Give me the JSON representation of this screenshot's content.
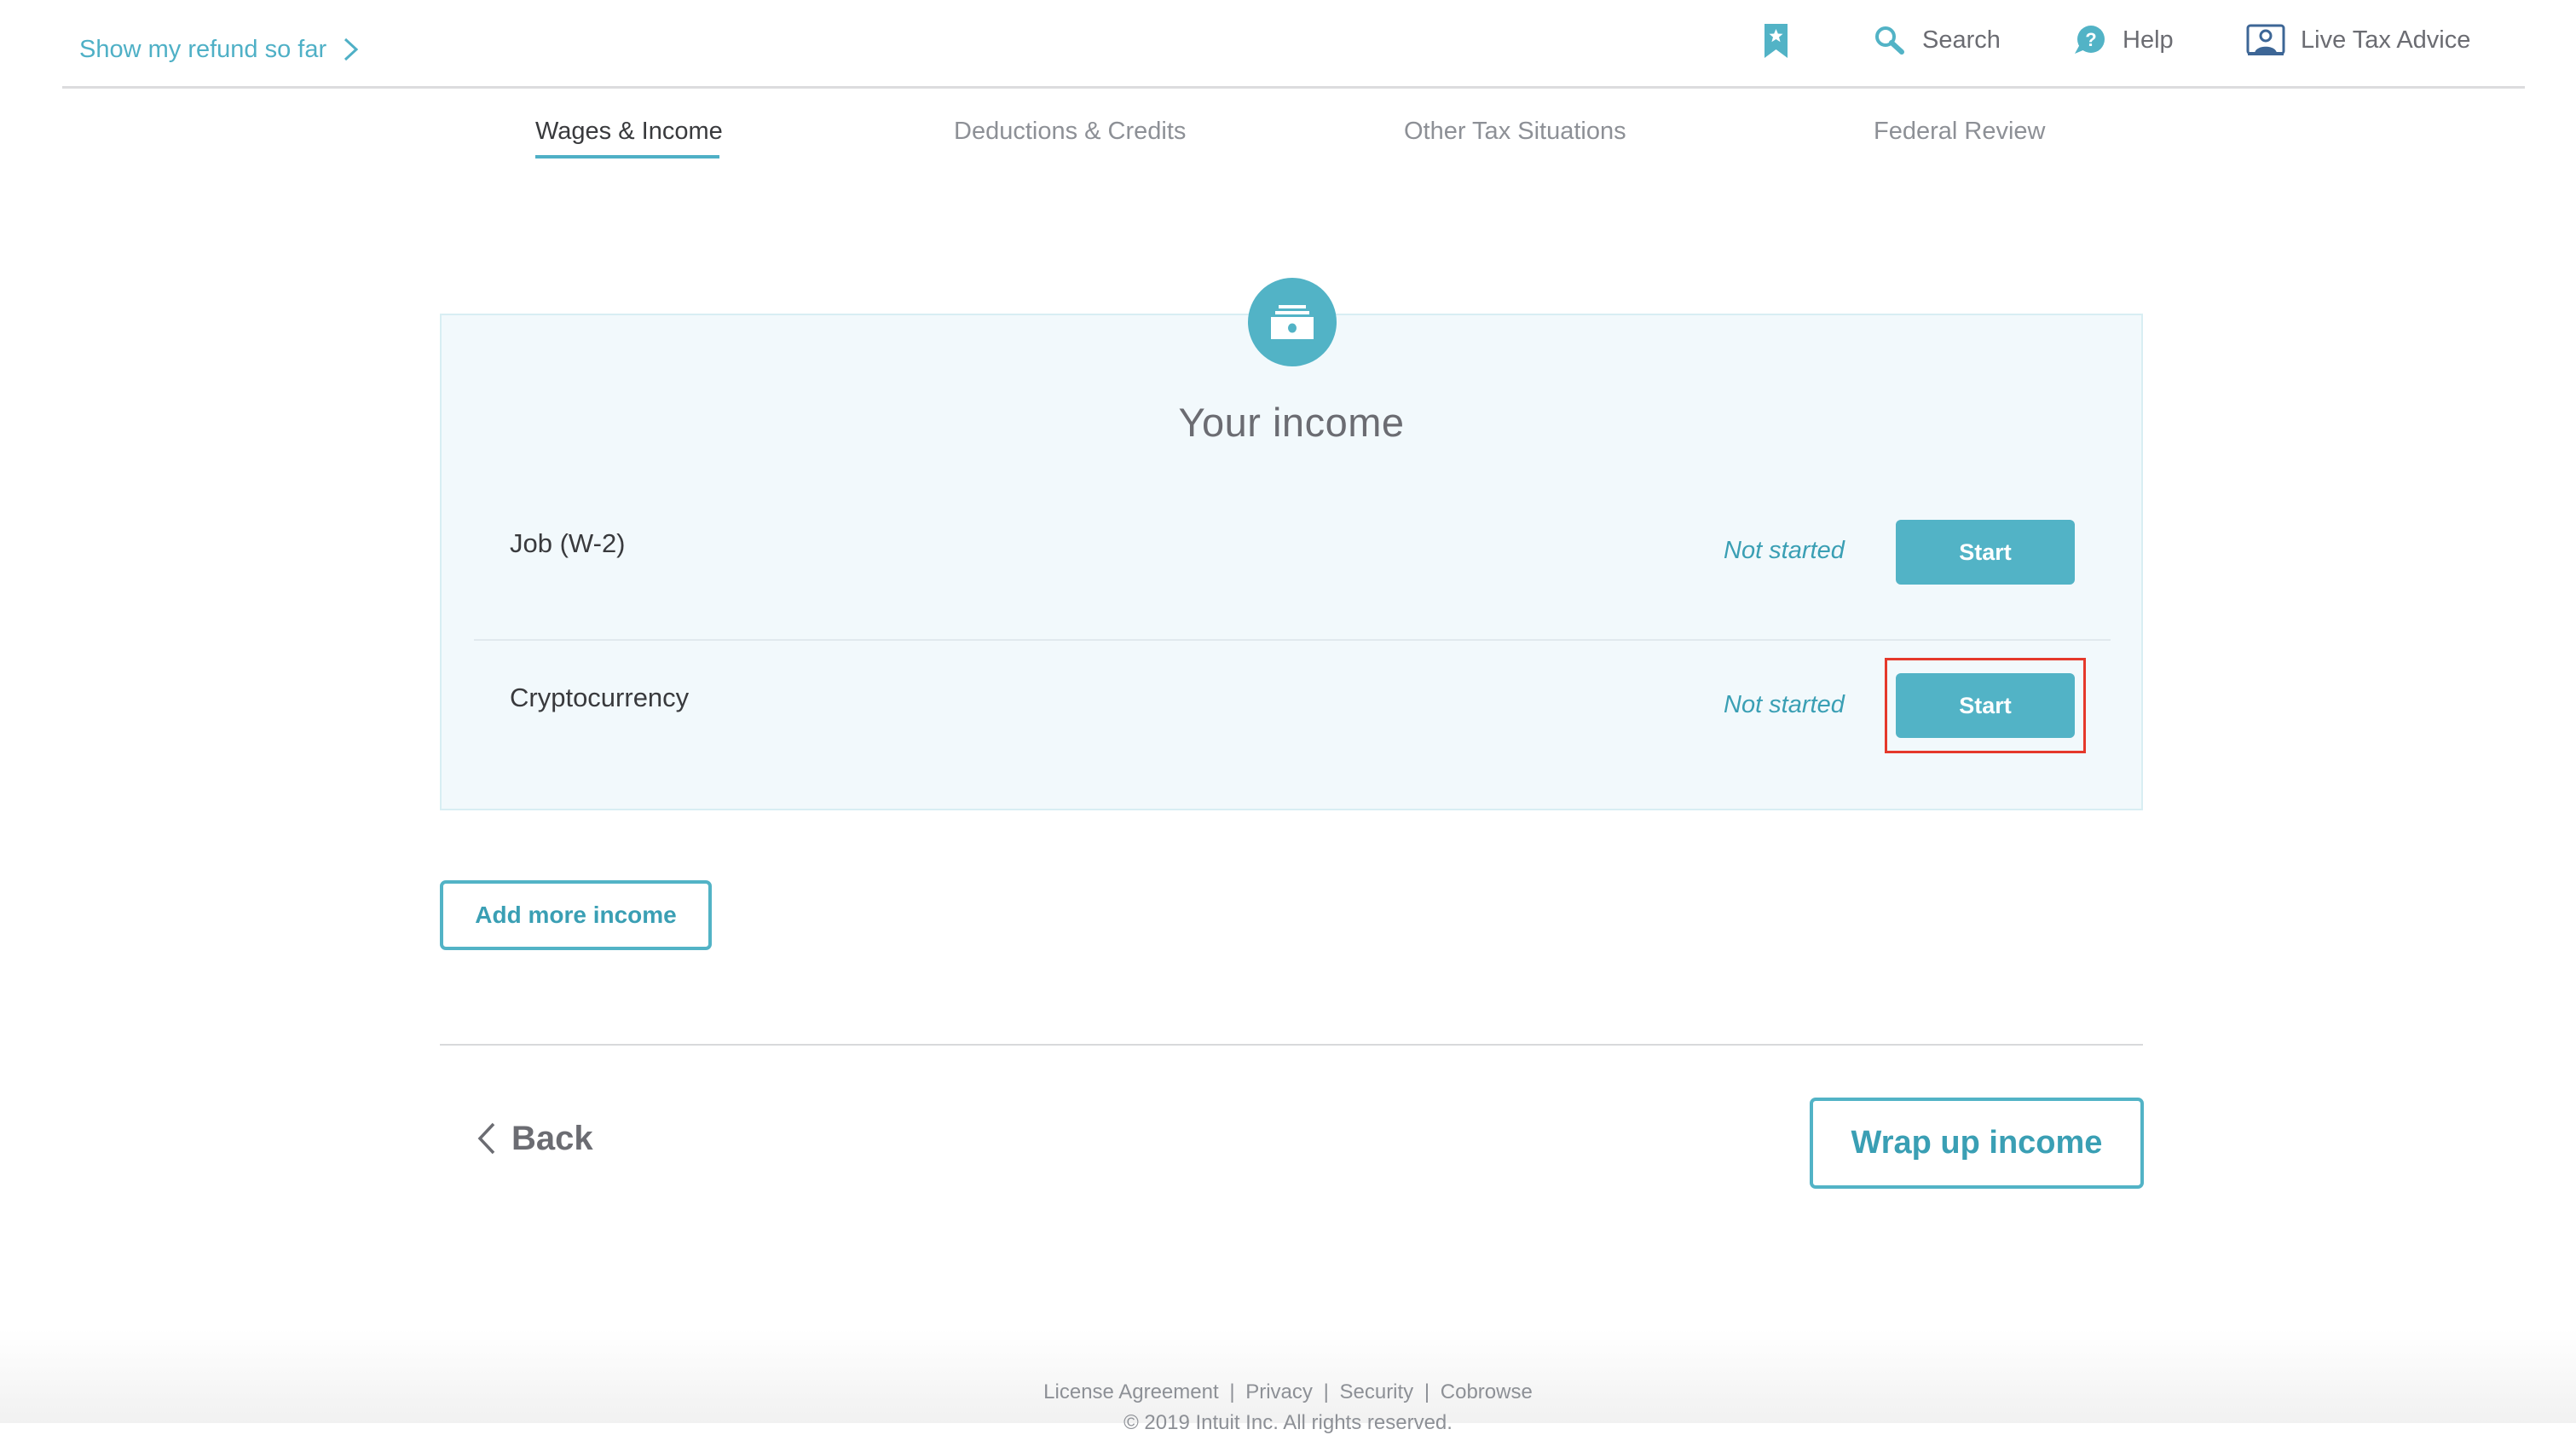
{
  "header": {
    "refund_link": "Show my refund so far",
    "icons": {
      "bookmark": "bookmark-star-icon",
      "search": "search-icon",
      "help": "help-question-icon",
      "live": "live-tax-advice-icon"
    },
    "search_label": "Search",
    "help_label": "Help",
    "live_label": "Live Tax Advice"
  },
  "tabs": [
    {
      "label": "Wages & Income",
      "active": true
    },
    {
      "label": "Deductions & Credits",
      "active": false
    },
    {
      "label": "Other Tax Situations",
      "active": false
    },
    {
      "label": "Federal Review",
      "active": false
    }
  ],
  "card": {
    "icon": "money-stack-icon",
    "title": "Your income",
    "rows": [
      {
        "label": "Job (W-2)",
        "status": "Not started",
        "button": "Start"
      },
      {
        "label": "Cryptocurrency",
        "status": "Not started",
        "button": "Start",
        "highlighted": true
      }
    ]
  },
  "actions": {
    "add_more": "Add more income",
    "back": "Back",
    "wrap_up": "Wrap up income"
  },
  "footer": {
    "links": [
      "License Agreement",
      "Privacy",
      "Security",
      "Cobrowse"
    ],
    "separator": "|",
    "copyright": "© 2019 Intuit Inc. All rights reserved."
  },
  "colors": {
    "accent": "#52b3c6",
    "accent_text": "#3a9fb4",
    "highlight": "#e5392b",
    "card_bg": "#f2f9fc",
    "live_icon": "#3d6696"
  }
}
